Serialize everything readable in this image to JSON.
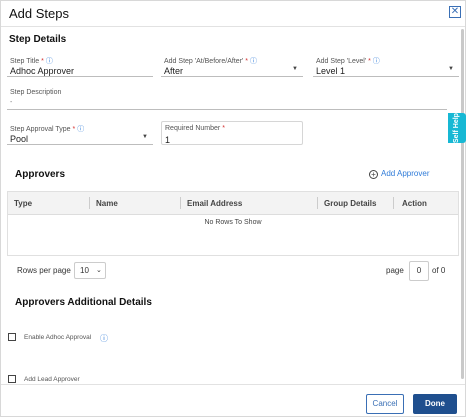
{
  "dialog": {
    "title": "Add Steps",
    "close_icon": "close-icon"
  },
  "step_details": {
    "heading": "Step Details",
    "step_title": {
      "label": "Step Title",
      "value": "Adhoc Approver"
    },
    "add_step_position": {
      "label": "Add Step 'At/Before/After'",
      "value": "After"
    },
    "add_step_level": {
      "label": "Add Step 'Level'",
      "value": "Level 1"
    },
    "step_description": {
      "label": "Step Description",
      "value": "-"
    },
    "approval_type": {
      "label": "Step Approval Type",
      "value": "Pool"
    },
    "required_number": {
      "label": "Required Number",
      "value": "1"
    },
    "required_mark": "*",
    "info_glyph": "ⓘ"
  },
  "self_help": {
    "label": "Self Help"
  },
  "approvers": {
    "heading": "Approvers",
    "add_label": "Add Approver",
    "columns": [
      "Type",
      "Name",
      "Email Address",
      "Group Details",
      "Action"
    ],
    "empty_text": "No Rows To Show",
    "rows_per_page_label": "Rows per page",
    "rows_per_page_value": "10",
    "page_label": "page",
    "page_value": "0",
    "of_label": "of 0"
  },
  "additional": {
    "heading": "Approvers Additional Details",
    "enable_adhoc_label": "Enable Adhoc Approval",
    "add_lead_label": "Add Lead Approver"
  },
  "footer": {
    "cancel_label": "Cancel",
    "done_label": "Done"
  },
  "colors": {
    "accent": "#2f7bd8",
    "primary_button": "#1f4f8e",
    "self_help": "#17b8d4"
  }
}
